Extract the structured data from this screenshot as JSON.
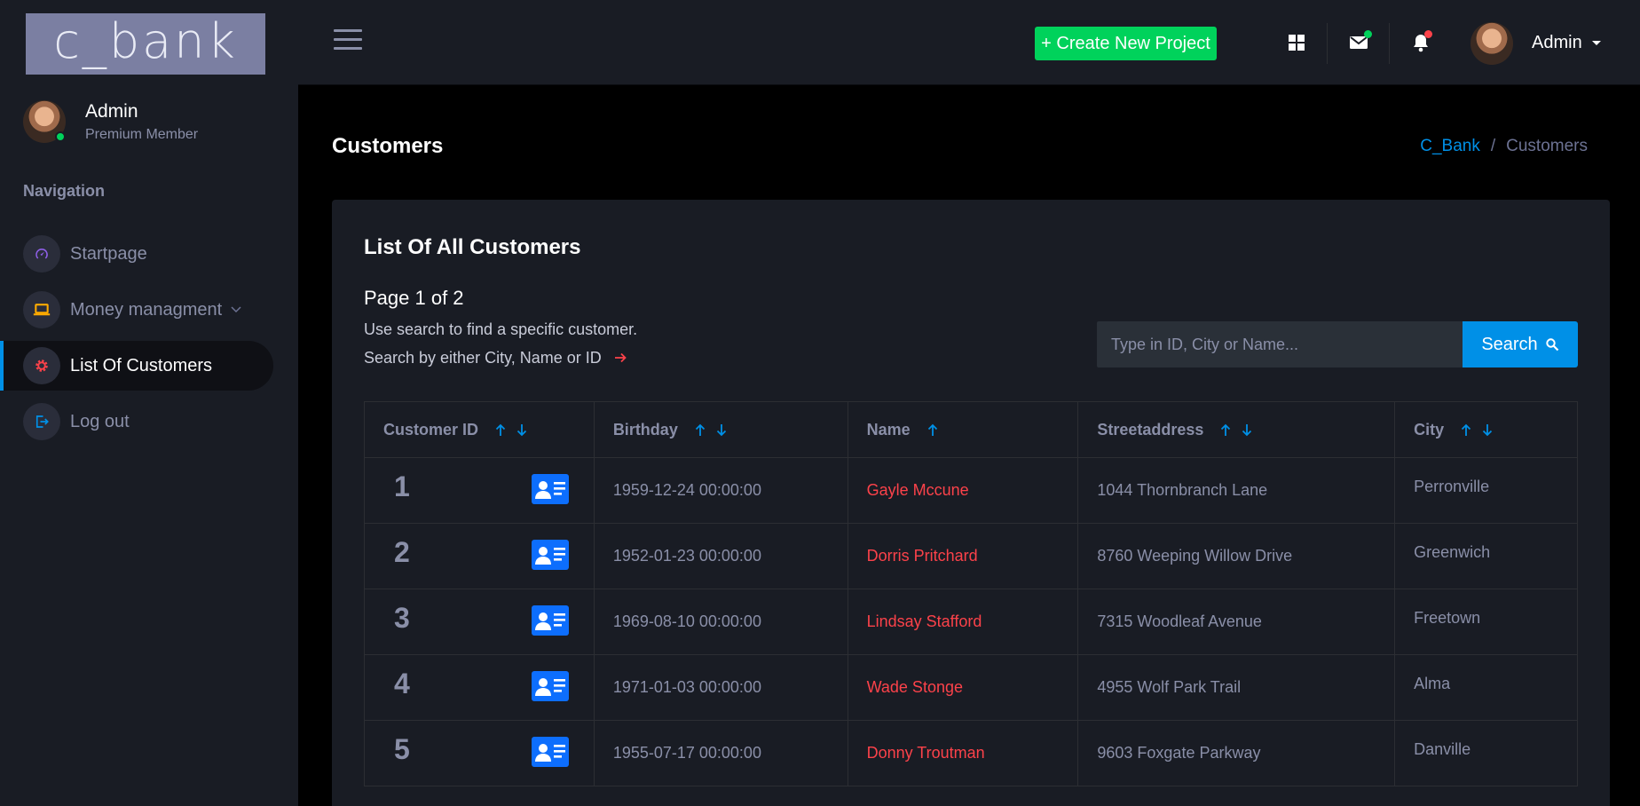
{
  "brand": {
    "logo_text": "c_bank"
  },
  "sidebar": {
    "profile": {
      "name": "Admin",
      "role": "Premium Member"
    },
    "nav_caption": "Navigation",
    "items": [
      {
        "label": "Startpage",
        "icon": "speedometer-icon",
        "color": "#8f5fe8"
      },
      {
        "label": "Money managment",
        "icon": "laptop-icon",
        "color": "#ffab00"
      },
      {
        "label": "List Of Customers",
        "icon": "settings-icon",
        "color": "#fc424a",
        "active": true
      },
      {
        "label": "Log out",
        "icon": "logout-icon",
        "color": "#0090e7"
      }
    ]
  },
  "topbar": {
    "create_label": "+ Create New Project",
    "user_name": "Admin",
    "icons": [
      "grid-icon",
      "mail-icon",
      "bell-icon"
    ]
  },
  "page": {
    "title": "Customers",
    "breadcrumb": {
      "root": "C_Bank",
      "current": "Customers"
    }
  },
  "card": {
    "title": "List Of All Customers",
    "page_info": "Page 1 of 2",
    "help_line1": "Use search to find a specific customer.",
    "help_line2": "Search by either City, Name or ID",
    "search_placeholder": "Type in ID, City or Name...",
    "search_label": "Search"
  },
  "table": {
    "headers": [
      "Customer ID",
      "Birthday",
      "Name",
      "Streetaddress",
      "City"
    ],
    "rows": [
      {
        "id": "1",
        "birthday": "1959-12-24 00:00:00",
        "name": "Gayle Mccune",
        "street": "1044 Thornbranch Lane",
        "city": "Perronville"
      },
      {
        "id": "2",
        "birthday": "1952-01-23 00:00:00",
        "name": "Dorris Pritchard",
        "street": "8760 Weeping Willow Drive",
        "city": "Greenwich"
      },
      {
        "id": "3",
        "birthday": "1969-08-10 00:00:00",
        "name": "Lindsay Stafford",
        "street": "7315 Woodleaf Avenue",
        "city": "Freetown"
      },
      {
        "id": "4",
        "birthday": "1971-01-03 00:00:00",
        "name": "Wade Stonge",
        "street": "4955 Wolf Park Trail",
        "city": "Alma"
      },
      {
        "id": "5",
        "birthday": "1955-07-17 00:00:00",
        "name": "Donny Troutman",
        "street": "9603 Foxgate Parkway",
        "city": "Danville"
      }
    ]
  },
  "colors": {
    "accent": "#0090e7",
    "success": "#00d25b",
    "danger": "#fc424a",
    "card_bg": "#191c24"
  }
}
